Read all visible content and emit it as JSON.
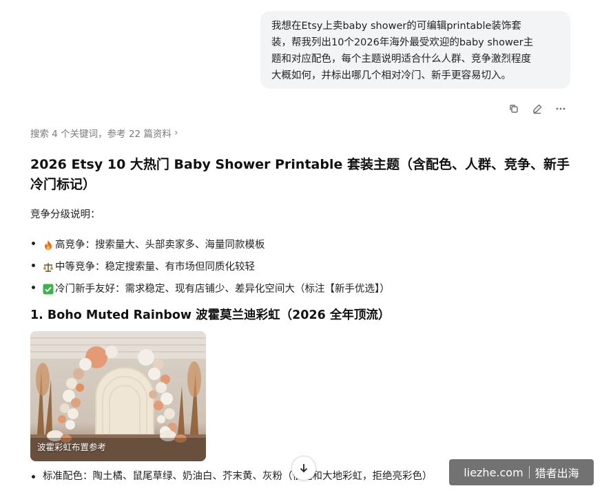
{
  "user_message": {
    "lines": [
      "我想在Etsy上卖baby shower的可编辑printable装饰套",
      "装，帮我列出10个2026年海外最受欢迎的baby shower主",
      "题和对应配色，每个主题说明适合什么人群、竞争激烈程度",
      "大概如何，并标出哪几个相对冷门、新手更容易切入。"
    ]
  },
  "actions": {
    "copy_icon": "copy-icon",
    "edit_icon": "edit-icon",
    "more_icon": "more-icon"
  },
  "search_summary": "搜索 4 个关键词，参考 22 篇资料",
  "answer": {
    "title_line1": "2026 Etsy 10 大热门 Baby Shower Printable 套装主题（含配色、人群、竞争、新手",
    "title_line2": "冷门标记）",
    "competition_label": "竞争分级说明：",
    "levels": [
      {
        "icon": "fire-emoji",
        "text": "高竞争：搜索量大、头部卖家多、海量同款模板"
      },
      {
        "icon": "balance-scale-emoji",
        "text": "中等竞争：稳定搜索量、有市场但同质化较轻"
      },
      {
        "icon": "check-mark-emoji",
        "text": "冷门新手友好：需求稳定、现有店铺少、差异化空间大（标注【新手优选】）"
      }
    ],
    "section1_heading": "1. Boho Muted Rainbow 波霍莫兰迪彩虹（2026 全年顶流）",
    "image_caption": "波霍彩虹布置参考",
    "color_line": "标准配色：陶土橘、鼠尾草绿、奶油白、芥末黄、灰粉（低饱和大地彩虹，拒绝亮彩色）"
  },
  "watermark": {
    "site": "liezhe.com",
    "name": "猎者出海"
  }
}
